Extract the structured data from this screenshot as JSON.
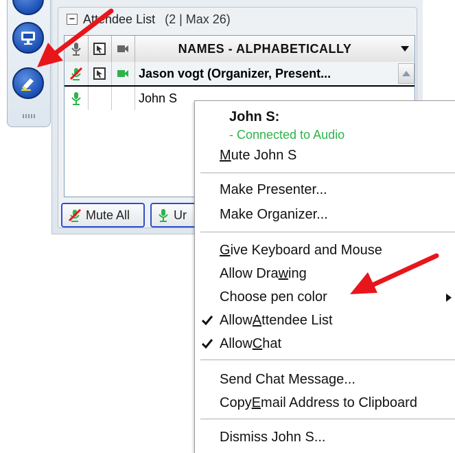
{
  "panel": {
    "title": "Attendee List",
    "count": "(2 | Max 26)",
    "collapse_glyph": "−"
  },
  "grid": {
    "header_name": "NAMES - ALPHABETICALLY",
    "rows": [
      {
        "name": "Jason vogt (Organizer, Present..."
      },
      {
        "name": "John S"
      }
    ]
  },
  "buttons": {
    "mute_all": "Mute All",
    "unmute_partial": "Ur"
  },
  "menu": {
    "header_name": "John S:",
    "status": "- Connected to Audio",
    "mute": {
      "pre": "",
      "ul": "M",
      "post": "ute John S"
    },
    "make_presenter": "Make Presenter...",
    "make_organizer": "Make Organizer...",
    "give_kb": {
      "pre": "",
      "ul": "G",
      "post": "ive Keyboard and Mouse"
    },
    "allow_drawing": {
      "pre": "Allow Dra",
      "ul": "w",
      "post": "ing"
    },
    "choose_pen": "Choose pen color",
    "allow_attendee": {
      "pre": "Allow ",
      "ul": "A",
      "post": "ttendee List"
    },
    "allow_chat": {
      "pre": "Allow ",
      "ul": "C",
      "post": "hat"
    },
    "send_chat": "Send Chat Message...",
    "copy_email": {
      "pre": "Copy ",
      "ul": "E",
      "post": "mail Address to Clipboard"
    },
    "dismiss": "Dismiss John S..."
  },
  "colors": {
    "audio_green": "#2db34a",
    "arrow_red": "#e8161b",
    "button_blue": "#2f4fc9"
  },
  "icons": [
    "presentation-icon",
    "highlighter-icon",
    "microphone-icon",
    "screen-share-icon",
    "video-camera-icon",
    "checkmark-icon",
    "submenu-arrow-icon"
  ]
}
